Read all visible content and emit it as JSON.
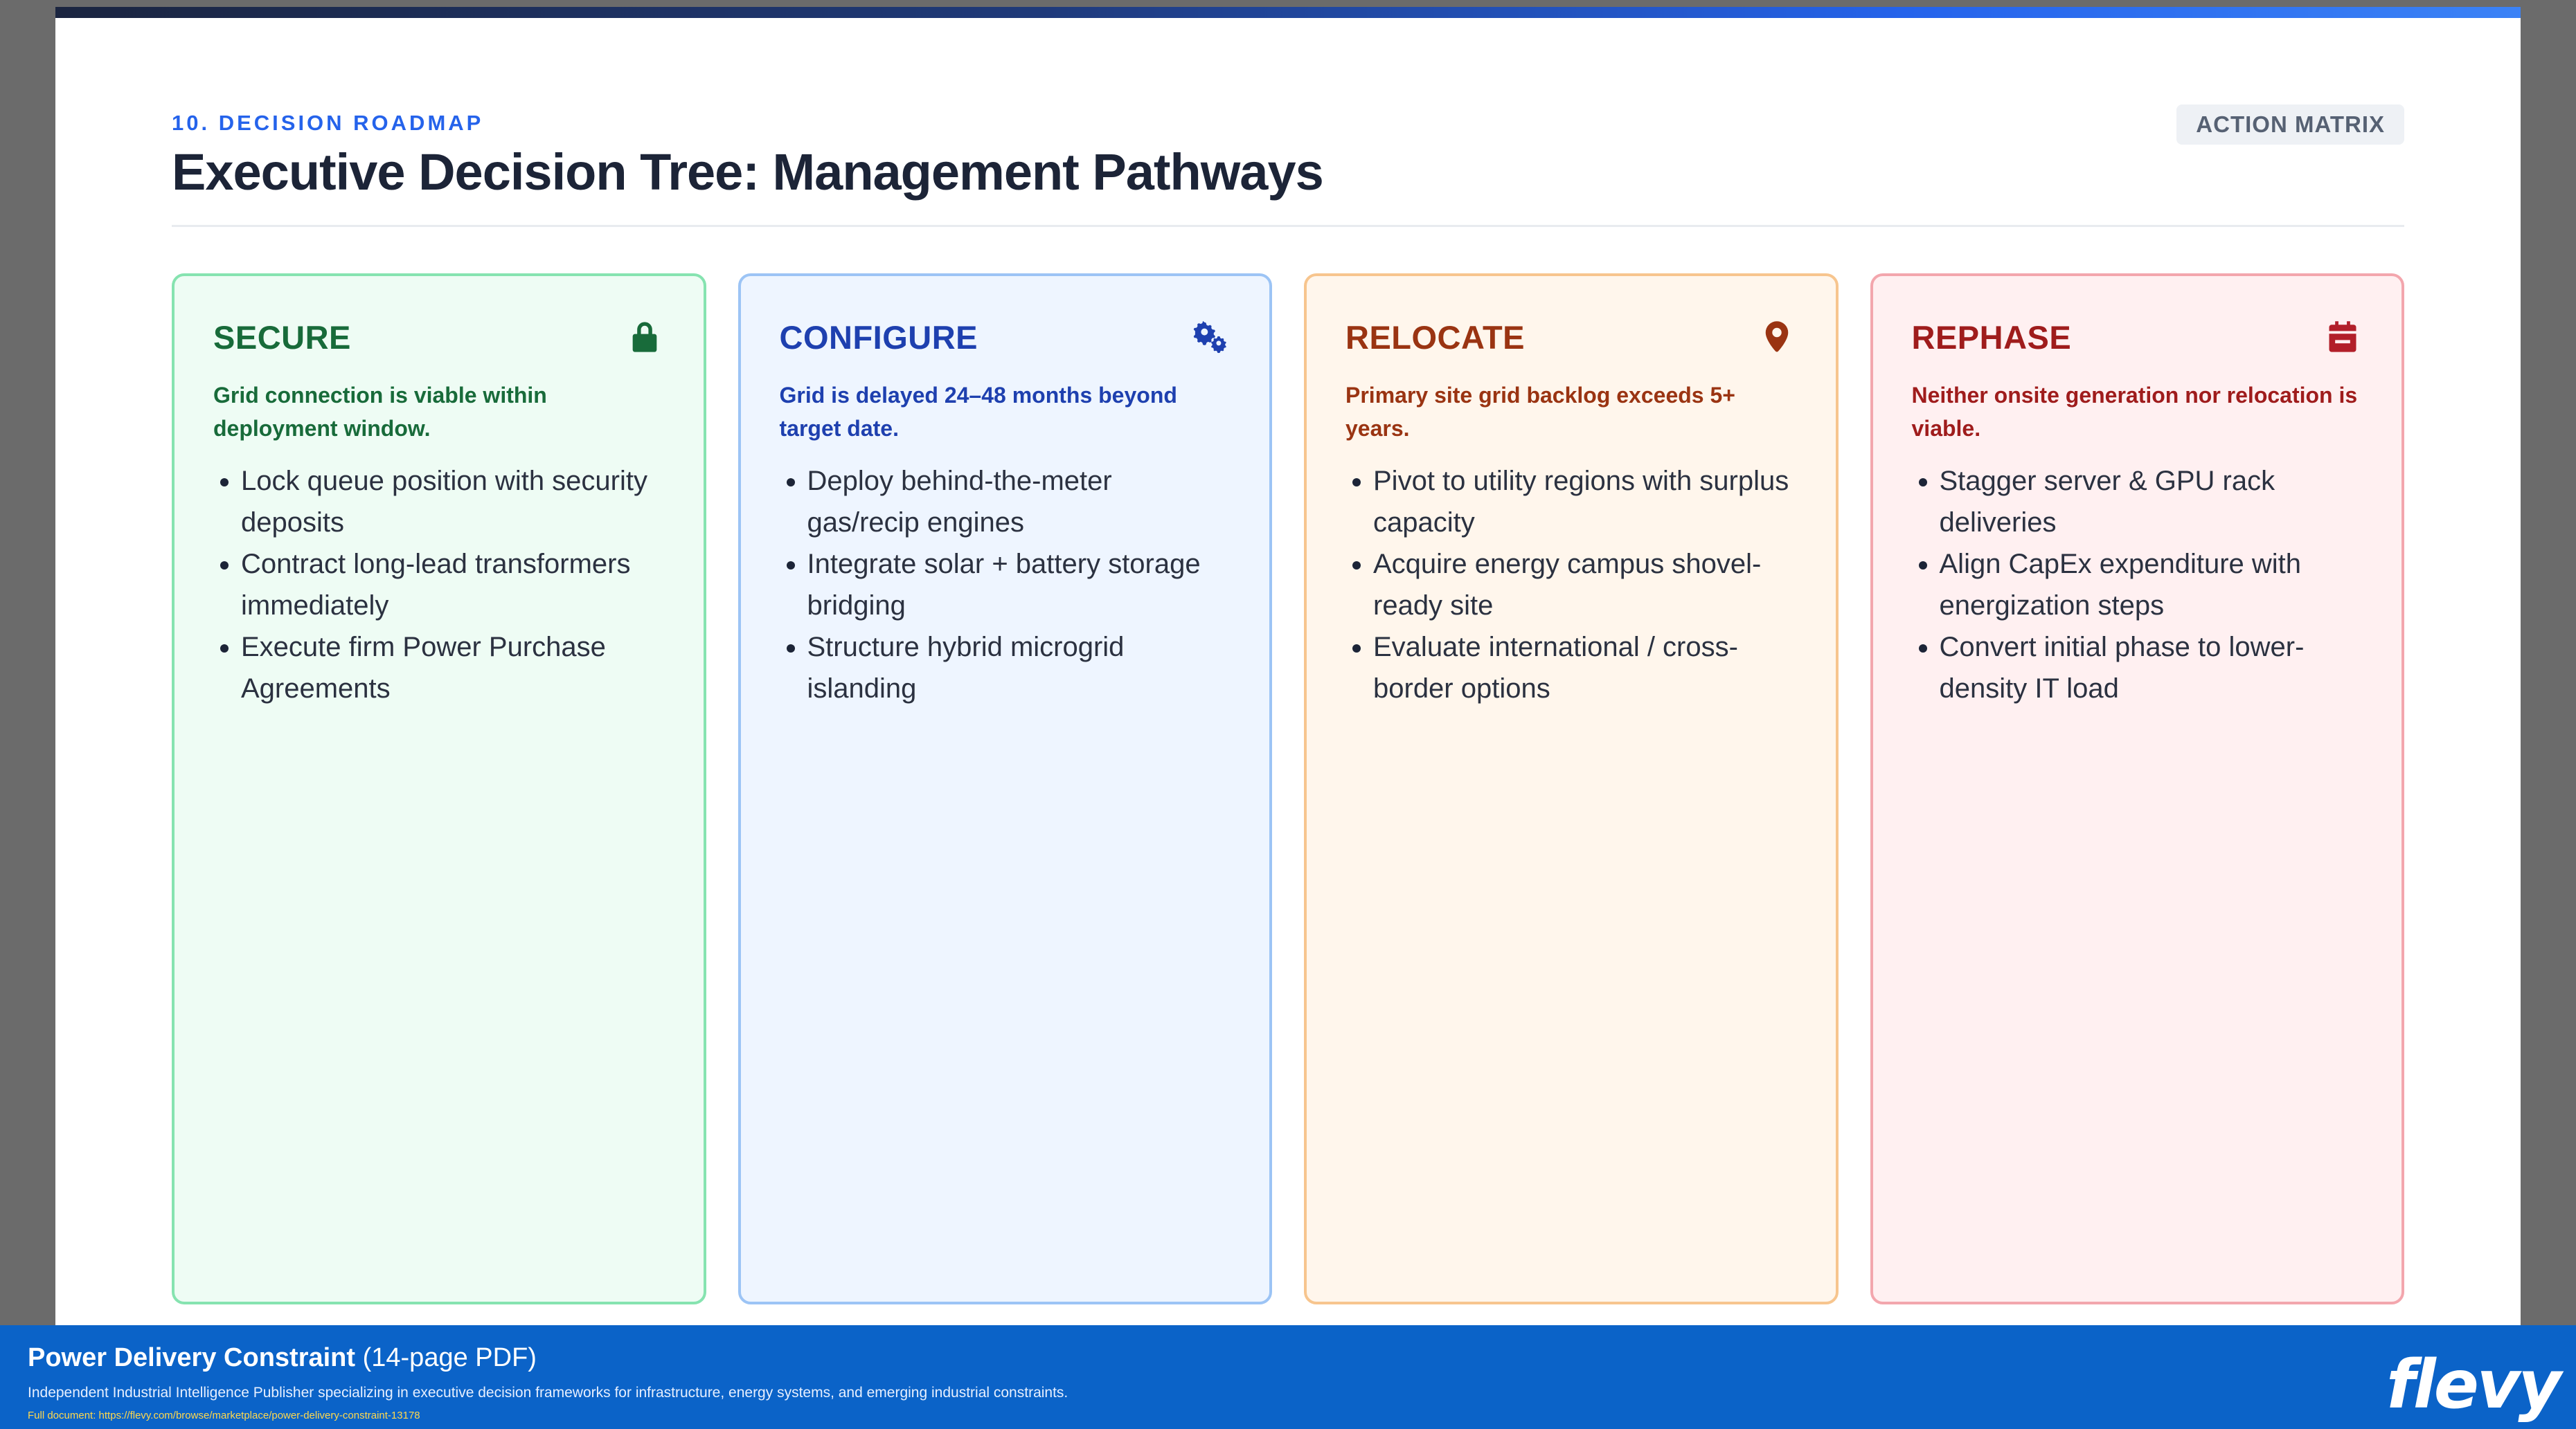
{
  "header": {
    "section_label": "10. DECISION ROADMAP",
    "title": "Executive Decision Tree: Management Pathways",
    "badge": "ACTION MATRIX"
  },
  "cards": [
    {
      "title": "SECURE",
      "icon": "lock-icon",
      "description": "Grid connection is viable within deployment window.",
      "bullets": [
        "Lock queue position with security deposits",
        "Contract long-lead transformers immediately",
        "Execute firm Power Purchase Agreements"
      ]
    },
    {
      "title": "CONFIGURE",
      "icon": "gears-icon",
      "description": "Grid is delayed 24–48 months beyond target date.",
      "bullets": [
        "Deploy behind-the-meter gas/recip engines",
        "Integrate solar + battery storage bridging",
        "Structure hybrid microgrid islanding"
      ]
    },
    {
      "title": "RELOCATE",
      "icon": "map-pin-icon",
      "description": "Primary site grid backlog exceeds 5+ years.",
      "bullets": [
        "Pivot to utility regions with surplus capacity",
        "Acquire energy campus shovel-ready site",
        "Evaluate international / cross-border options"
      ]
    },
    {
      "title": "REPHASE",
      "icon": "calendar-icon",
      "description": "Neither onsite generation nor relocation is viable.",
      "bullets": [
        "Stagger server & GPU rack deliveries",
        "Align CapEx expenditure with energization steps",
        "Convert initial phase to lower-density IT load"
      ]
    }
  ],
  "footer": {
    "doc_name": "Power Delivery Constraint",
    "doc_pages": "(14-page PDF)",
    "description": "Independent Industrial Intelligence Publisher specializing in executive decision frameworks for infrastructure, energy systems, and emerging industrial constraints.",
    "url": "Full document: https://flevy.com/browse/marketplace/power-delivery-constraint-13178",
    "logo": "flevy"
  }
}
